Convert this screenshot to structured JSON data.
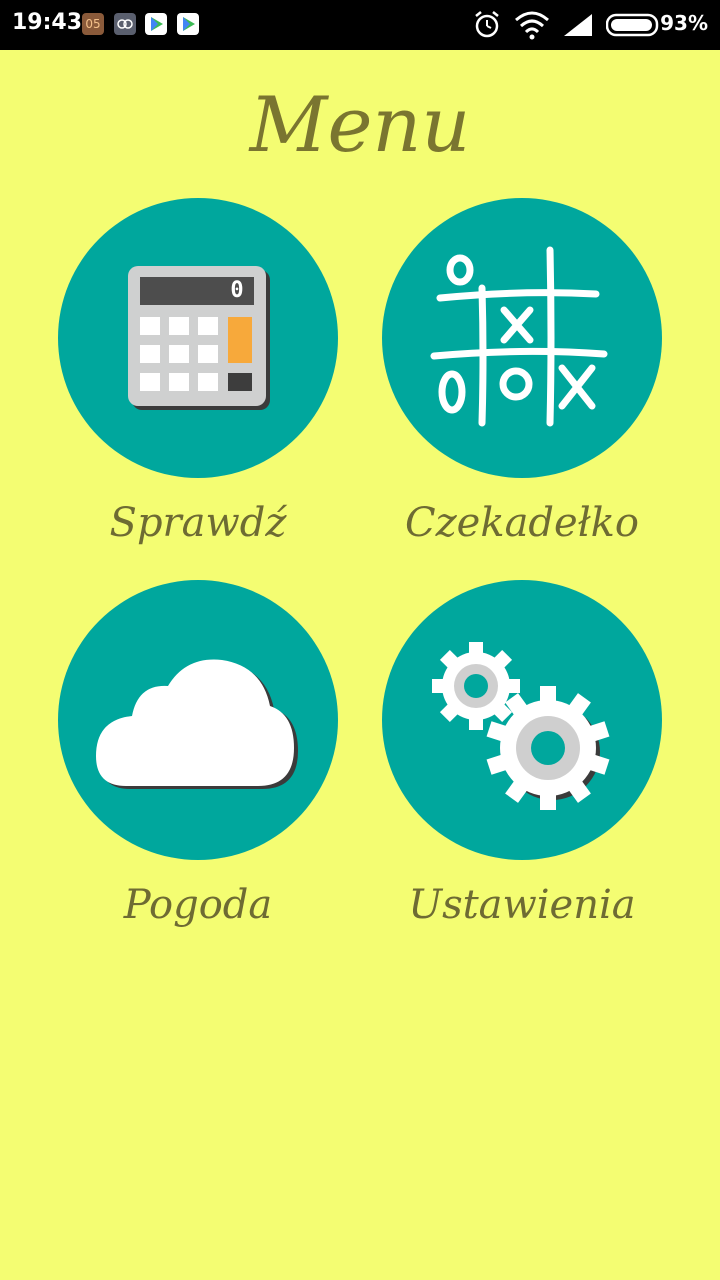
{
  "status_bar": {
    "time": "19:43",
    "notif_badge": "05",
    "battery_pct": "93%"
  },
  "title": "Menu",
  "menu": [
    {
      "label": "Sprawdź",
      "icon": "calculator-icon"
    },
    {
      "label": "Czekadełko",
      "icon": "tic-tac-toe-icon"
    },
    {
      "label": "Pogoda",
      "icon": "cloud-icon"
    },
    {
      "label": "Ustawienia",
      "icon": "gears-icon"
    }
  ],
  "calculator_display": "0",
  "colors": {
    "background": "#f4fd72",
    "tile": "#00a79d",
    "title_text": "#7a7530"
  }
}
